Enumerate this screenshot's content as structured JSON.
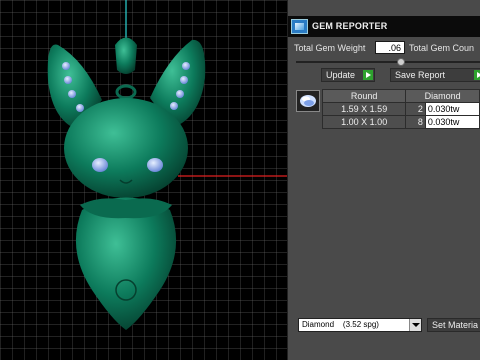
{
  "panel": {
    "title": "GEM REPORTER",
    "total_weight_label": "Total Gem Weight",
    "total_weight_value": ".06",
    "total_count_label": "Total Gem Coun",
    "update_label": "Update",
    "save_report_label": "Save Report",
    "table": {
      "headers": [
        "Round",
        "Diamond"
      ],
      "rows": [
        {
          "size": "1.59 X 1.59",
          "count": "2",
          "weight": "0.030tw"
        },
        {
          "size": "1.00 X 1.00",
          "count": "8",
          "weight": "0.030tw"
        }
      ]
    },
    "material_select": "Diamond    (3.52 spg)",
    "set_material_label": "Set Materia"
  },
  "icons": {
    "logo": "gem-reporter-logo-icon",
    "gem": "round-gem-icon",
    "arrow": "play-arrow-icon",
    "dropdown": "chevron-down-icon"
  },
  "colors": {
    "model": "#0f7a5e",
    "gems": "#8fb0ea",
    "panel": "#4a4a4a",
    "grid": "#5a5a5a",
    "axis_red": "#e02020",
    "axis_cyan": "#2bd4d4",
    "go_arrow": "#2ea22e"
  }
}
